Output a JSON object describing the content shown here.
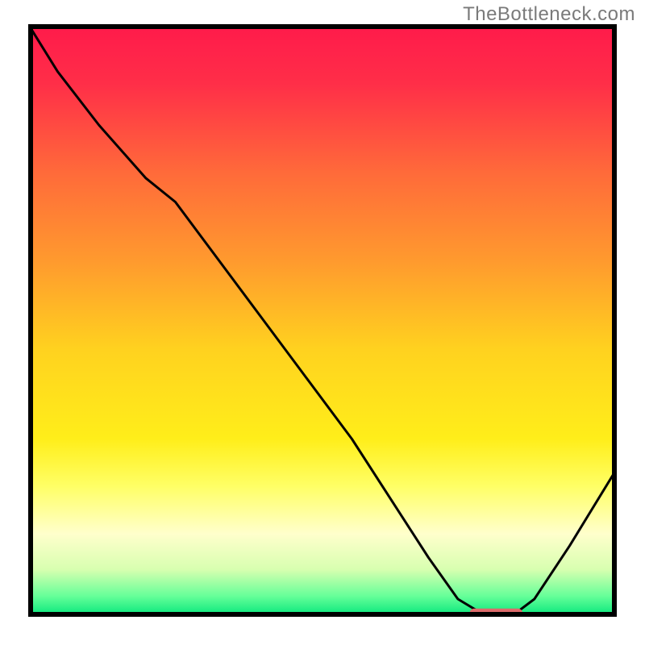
{
  "watermark": "TheBottleneck.com",
  "chart_data": {
    "type": "line",
    "title": "",
    "xlabel": "",
    "ylabel": "",
    "xlim": [
      0,
      100
    ],
    "ylim": [
      0,
      100
    ],
    "grid": false,
    "legend": false,
    "annotations": [],
    "background_gradient": {
      "stops": [
        {
          "offset": 0.0,
          "color": "#ff1a4b"
        },
        {
          "offset": 0.1,
          "color": "#ff2e48"
        },
        {
          "offset": 0.25,
          "color": "#ff6a3a"
        },
        {
          "offset": 0.4,
          "color": "#ff9a2e"
        },
        {
          "offset": 0.55,
          "color": "#ffd21f"
        },
        {
          "offset": 0.7,
          "color": "#ffee1a"
        },
        {
          "offset": 0.78,
          "color": "#ffff66"
        },
        {
          "offset": 0.86,
          "color": "#ffffcc"
        },
        {
          "offset": 0.92,
          "color": "#d8ffb0"
        },
        {
          "offset": 0.965,
          "color": "#66ff99"
        },
        {
          "offset": 1.0,
          "color": "#00e57a"
        }
      ]
    },
    "series": [
      {
        "name": "curve",
        "color": "#000000",
        "x": [
          0,
          5,
          12,
          20,
          25,
          40,
          55,
          68,
          73,
          78,
          82,
          86,
          92,
          100
        ],
        "y": [
          100,
          92,
          83,
          74,
          70,
          50,
          30,
          10,
          3,
          0,
          0,
          3,
          12,
          25
        ]
      }
    ],
    "optimal_range_marker": {
      "x_start": 75,
      "x_end": 84,
      "y": 0.6,
      "color": "#dd6b6b",
      "thickness_pct": 1.6
    },
    "axes_color": "#000000",
    "axes_thickness_px": 6
  }
}
